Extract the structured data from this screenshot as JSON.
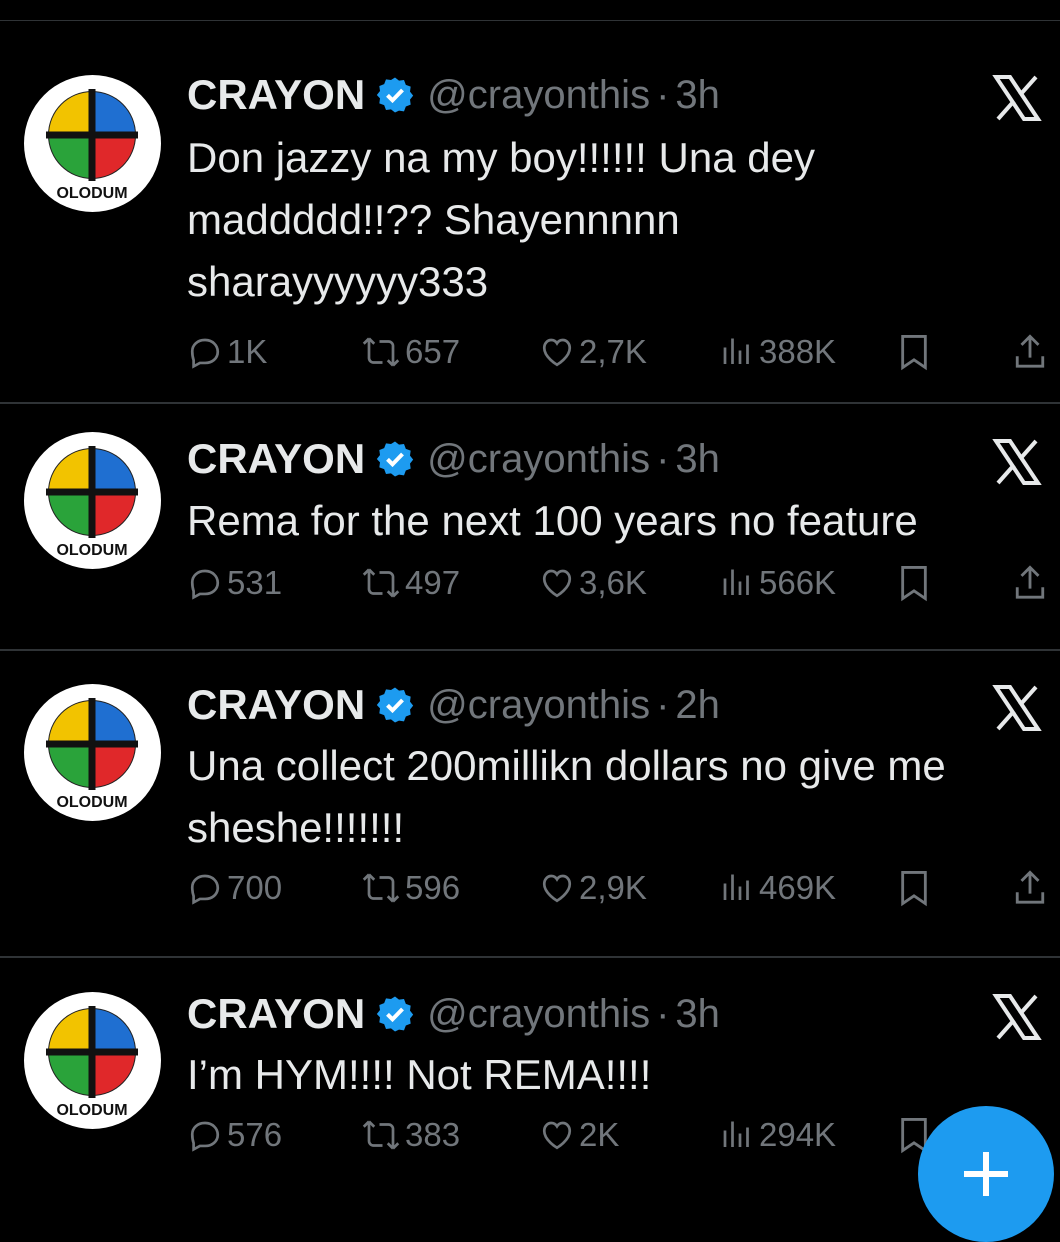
{
  "tweets": [
    {
      "name": "CRAYON",
      "handle": "@crayonthis",
      "dot": "·",
      "time": "3h",
      "avatar_label": "OLODUM",
      "text": "Don jazzy na my boy!!!!!! Una dey\nmaddddd!!?? Shayennnnn\nsharayyyyyy333",
      "replies": "1K",
      "reposts": "657",
      "likes": "2,7K",
      "views": "388K"
    },
    {
      "name": "CRAYON",
      "handle": "@crayonthis",
      "dot": "·",
      "time": "3h",
      "avatar_label": "OLODUM",
      "text": "Rema for the next 100 years no feature",
      "replies": "531",
      "reposts": "497",
      "likes": "3,6K",
      "views": "566K"
    },
    {
      "name": "CRAYON",
      "handle": "@crayonthis",
      "dot": "·",
      "time": "2h",
      "avatar_label": "OLODUM",
      "text": "Una collect 200millikn dollars no give me\nsheshe!!!!!!!",
      "replies": "700",
      "reposts": "596",
      "likes": "2,9K",
      "views": "469K"
    },
    {
      "name": "CRAYON",
      "handle": "@crayonthis",
      "dot": "·",
      "time": "3h",
      "avatar_label": "OLODUM",
      "text": "I’m HYM!!!! Not REMA!!!!",
      "replies": "576",
      "reposts": "383",
      "likes": "2K",
      "views": "294K"
    }
  ],
  "icons": {
    "reply": "reply-icon",
    "repost": "repost-icon",
    "like": "heart-icon",
    "views": "views-icon",
    "bookmark": "bookmark-icon",
    "share": "share-icon",
    "verified": "verified-badge-icon",
    "grok": "x-logo-icon",
    "compose": "plus-icon"
  },
  "colors": {
    "background": "#000000",
    "text": "#e7e9ea",
    "muted": "#71767b",
    "divider": "#2f3336",
    "accent": "#1d9bf0"
  }
}
